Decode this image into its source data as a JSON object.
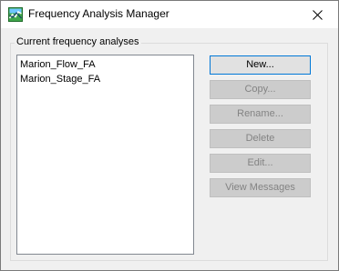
{
  "window": {
    "title": "Frequency Analysis Manager"
  },
  "group": {
    "label": "Current frequency analyses"
  },
  "analyses": [
    "Marion_Flow_FA",
    "Marion_Stage_FA"
  ],
  "buttons": {
    "new": "New...",
    "copy": "Copy...",
    "rename": "Rename...",
    "delete": "Delete",
    "edit": "Edit...",
    "view_messages": "View Messages"
  },
  "colors": {
    "default_button_border": "#0078d7",
    "disabled_text": "#838383"
  },
  "icons": {
    "app": "frequency-chart-icon",
    "close": "close-icon"
  }
}
